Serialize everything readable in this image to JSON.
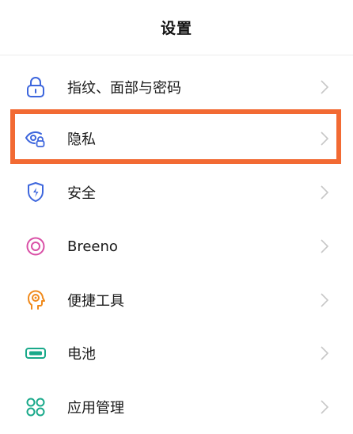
{
  "header": {
    "title": "设置"
  },
  "items": [
    {
      "label": "指纹、面部与密码",
      "icon": "lock-icon",
      "color": "#3d66dd"
    },
    {
      "label": "隐私",
      "icon": "privacy-eye-icon",
      "color": "#3d66dd"
    },
    {
      "label": "安全",
      "icon": "shield-icon",
      "color": "#3d66dd"
    },
    {
      "label": "Breeno",
      "icon": "breeno-icon",
      "color": "#d94fa6"
    },
    {
      "label": "便捷工具",
      "icon": "smart-tools-icon",
      "color": "#f08a1c"
    },
    {
      "label": "电池",
      "icon": "battery-icon",
      "color": "#19a98a"
    },
    {
      "label": "应用管理",
      "icon": "apps-icon",
      "color": "#19a98a"
    }
  ],
  "colors": {
    "highlight": "#f26a33",
    "chevron": "#c7c7c7"
  }
}
